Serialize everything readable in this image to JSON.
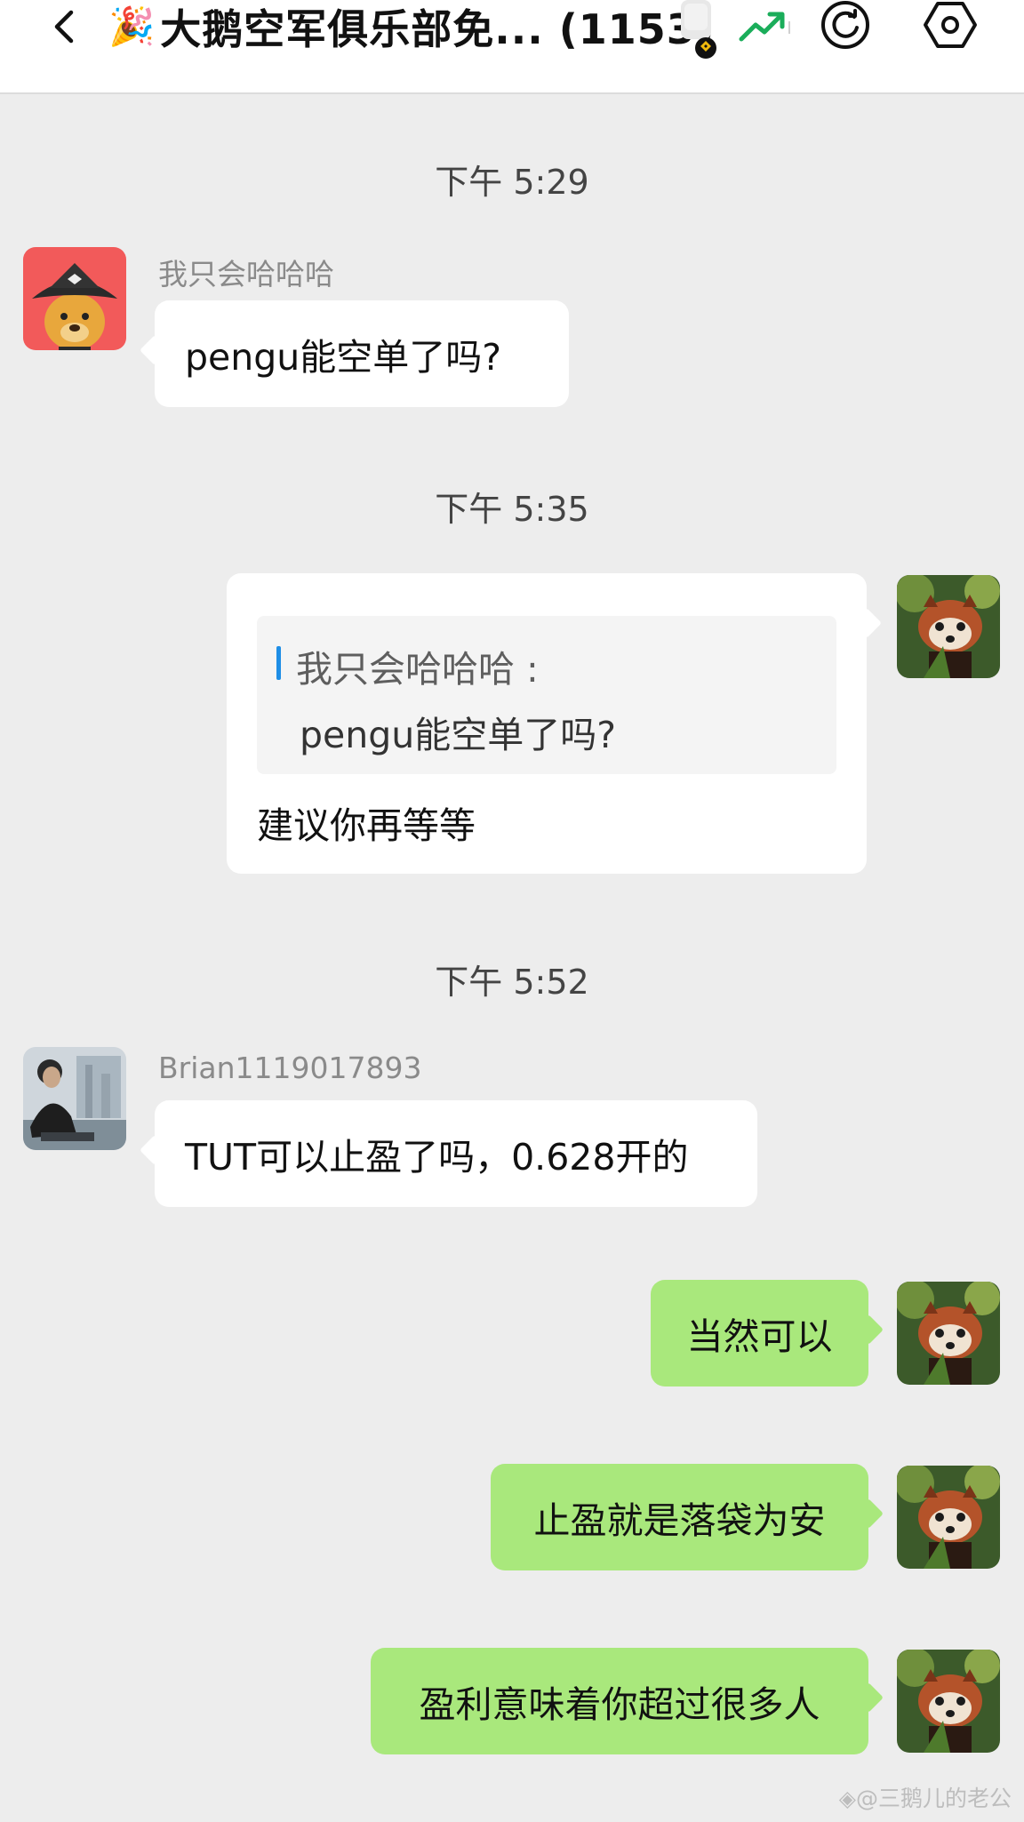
{
  "header": {
    "party_emoji": "🎉",
    "title": "大鹅空军俱乐部免... (1153)"
  },
  "timestamps": [
    "下午 5:29",
    "下午 5:35",
    "下午 5:52"
  ],
  "messages": [
    {
      "sender": "我只会哈哈哈",
      "text": "pengu能空单了吗?"
    },
    {
      "quote_author": "我只会哈哈哈 :",
      "quote_text": "pengu能空单了吗?",
      "text": "建议你再等等"
    },
    {
      "sender": "Brian1119017893",
      "text": "TUT可以止盈了吗，0.628开的"
    },
    {
      "text": "当然可以"
    },
    {
      "text": "止盈就是落袋为安"
    },
    {
      "text": "盈利意味着你超过很多人"
    }
  ],
  "watermark": "◈@三鹅儿的老公",
  "colors": {
    "chat_background": "#ededed",
    "self_bubble": "#a9e87c",
    "other_bubble": "#ffffff",
    "quote_bar": "#1e8ee6",
    "trend_green": "#1aad5a"
  }
}
